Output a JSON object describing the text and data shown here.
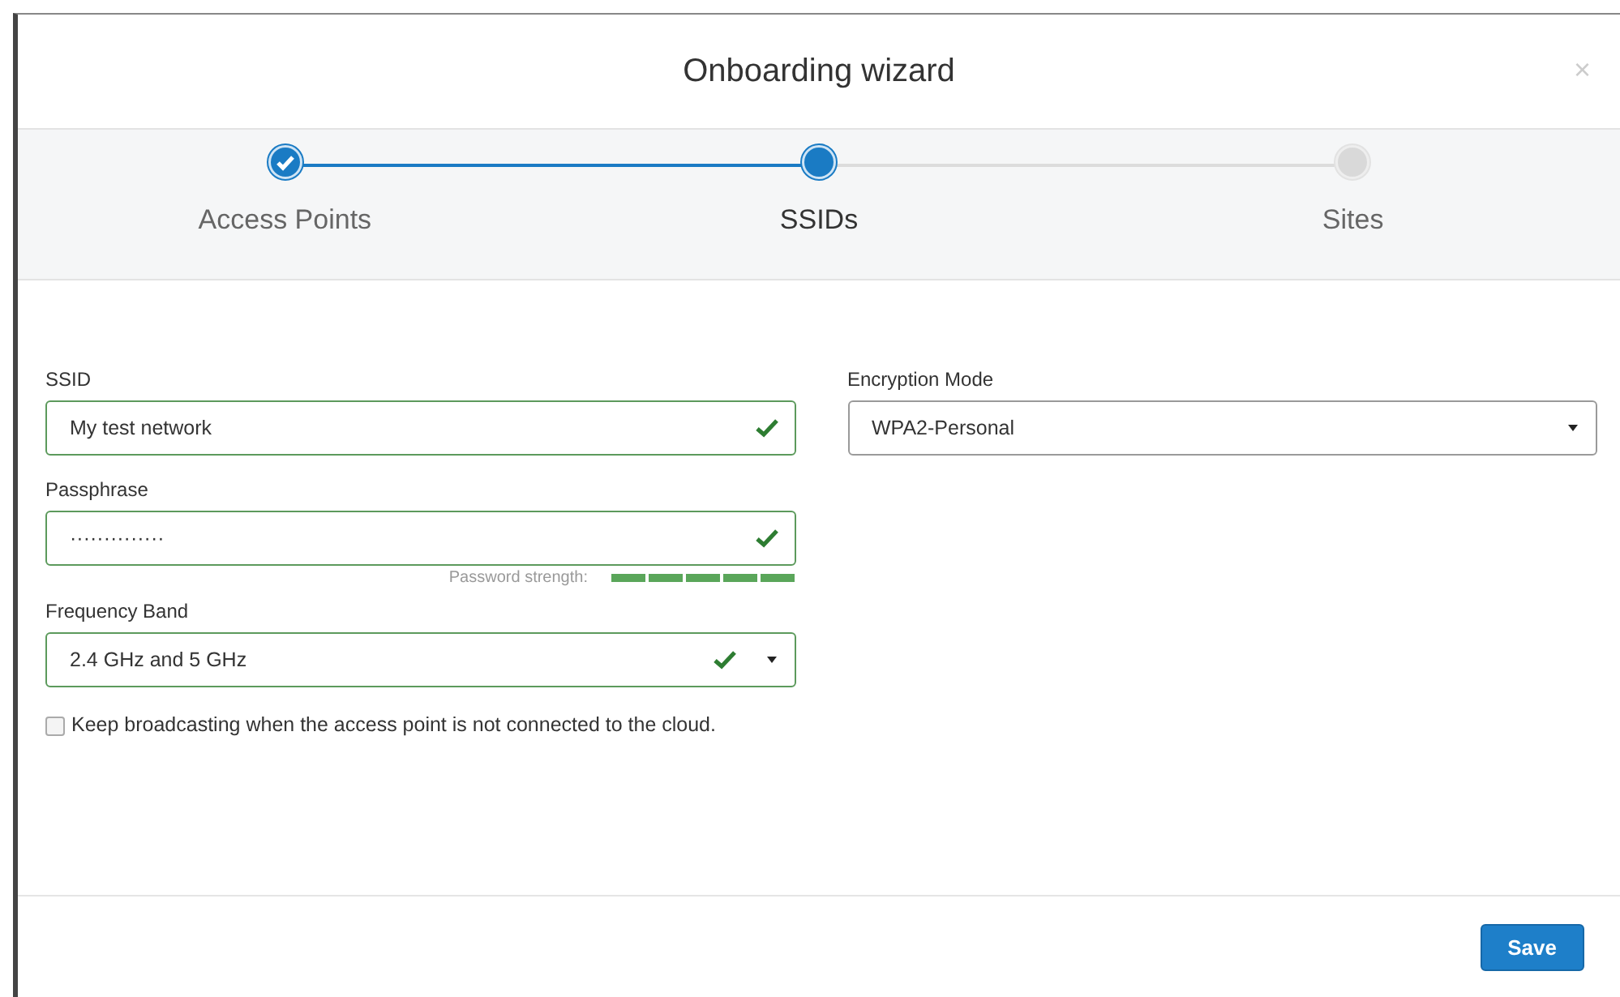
{
  "dialog": {
    "title": "Onboarding wizard",
    "close": "×"
  },
  "steps": [
    {
      "label": "Access Points",
      "done": true,
      "selected": false
    },
    {
      "label": "SSIDs",
      "done": false,
      "selected": true
    },
    {
      "label": "Sites",
      "done": false,
      "selected": false
    }
  ],
  "left_fields": [
    {
      "kind": "text",
      "label": "SSID",
      "value": "My test network",
      "valid": true
    },
    {
      "kind": "password",
      "label": "Passphrase",
      "value": "··············",
      "valid": true,
      "strength": {
        "label": "Password strength:",
        "level": 1
      }
    },
    {
      "kind": "select",
      "label": "Frequency Band",
      "value": "2.4 GHz and 5 GHz",
      "valid": true
    }
  ],
  "right_fields": [
    {
      "kind": "select",
      "label": "Encryption Mode",
      "value": "WPA2-Personal",
      "valid": false
    }
  ],
  "checkbox": {
    "label": "Keep broadcasting when the access point is not connected to the cloud.",
    "checked": false
  },
  "buttons": [
    {
      "label": "Save"
    }
  ]
}
